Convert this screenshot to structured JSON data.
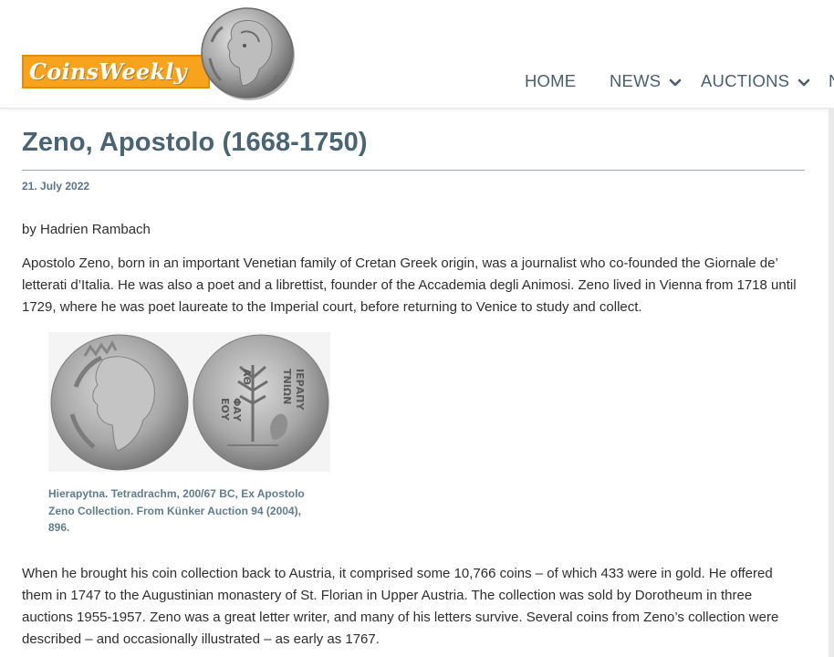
{
  "header": {
    "logo_text": "CoinsWeekly",
    "nav": [
      {
        "label": "HOME",
        "has_dropdown": false
      },
      {
        "label": "NEWS",
        "has_dropdown": true
      },
      {
        "label": "AUCTIONS",
        "has_dropdown": true
      },
      {
        "label": "N",
        "has_dropdown": false
      }
    ]
  },
  "article": {
    "title": "Zeno, Apostolo (1668-1750)",
    "date": "21. July 2022",
    "byline": "by Hadrien Rambach",
    "paragraph1": "Apostolo Zeno, born in an important Venetian family of Cretan Greek origin, was a journalist who co-founded the Giornale de’ letterati d’Italia. He was also a poet and a librettist, founder of the Accademia degli Animosi. Zeno lived in Vienna from 1718 until 1729, where he was poet laureate to the Imperial court, before returning to Venice to study and collect.",
    "figure": {
      "caption": "Hierapytna. Tetradrachm, 200/67 BC, Ex Apostolo Zeno Collection. From Künker Auction 94 (2004), 896.",
      "coin_reverse_lines": [
        "ΙΕΡΑΠΥ",
        "ΤΝΙΩΝ",
        "ΑΘ",
        "ΦΑΥ",
        "ΕΟΥ"
      ]
    },
    "paragraph2": "When he brought his coin collection back to Austria, it comprised some 10,766 coins – of which 433 were in gold. He offered them in 1747 to the Augustinian monastery of St. Florian in Upper Austria. The collection was sold by Dorotheum in three auctions 1955-1957. Zeno was a great letter writer, and many of his letters survive. Several coins from Zeno’s collection were described – and occasionally illustrated – as early as 1767."
  },
  "colors": {
    "logo_orange": "#f7a31c",
    "nav_text": "#4b5f6b",
    "title": "#4a6474",
    "date": "#5b7585",
    "caption": "#627c8c"
  },
  "icons": {
    "logo_coin": "silver-coin-icon",
    "dropdown": "chevron-down-icon"
  }
}
